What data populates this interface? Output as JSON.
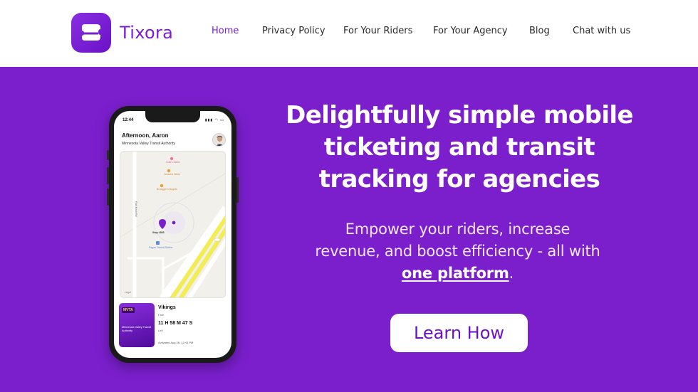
{
  "brand": {
    "name": "Tixora",
    "color": "#7a1fd0"
  },
  "nav": {
    "items": [
      {
        "label": "Home",
        "active": true
      },
      {
        "label": "Privacy Policy",
        "active": false
      },
      {
        "label": "For Your Riders",
        "active": false
      },
      {
        "label": "For Your Agency",
        "active": false
      },
      {
        "label": "Blog",
        "active": false
      },
      {
        "label": "Chat with us",
        "active": false
      }
    ]
  },
  "hero": {
    "background": "#7b1fcd",
    "headline": "Delightfully simple mobile ticketing and transit tracking for agencies",
    "subline_prefix": "Empower your riders, increase revenue, and boost efficiency - all with ",
    "subline_link": "one platform",
    "subline_suffix": ".",
    "cta_label": "Learn How"
  },
  "phone": {
    "status_time": "12:44",
    "status_icons": "▮▮▮ ◠ ▭",
    "greeting": "Afternoon, Aaron",
    "agency": "Minnesota Valley Transit Authority",
    "map": {
      "poi_1": "Cole's Salon",
      "poi_2": "Lessons Clinic",
      "poi_3": "Bruegger's Bagels",
      "stop": "Stop #535",
      "station": "Eagan Transit Station",
      "street": "Pilot Knob Rd",
      "legal": "Legal"
    },
    "ticket": {
      "logo": "MVTA",
      "agency": "Minnesota Valley Transit Authority",
      "name": "Vikings",
      "fare_label": "Fare",
      "timer": "11 H 58 M 47 S",
      "left_label": "Left",
      "activated": "Activated Aug 28, 12:43 PM"
    }
  }
}
